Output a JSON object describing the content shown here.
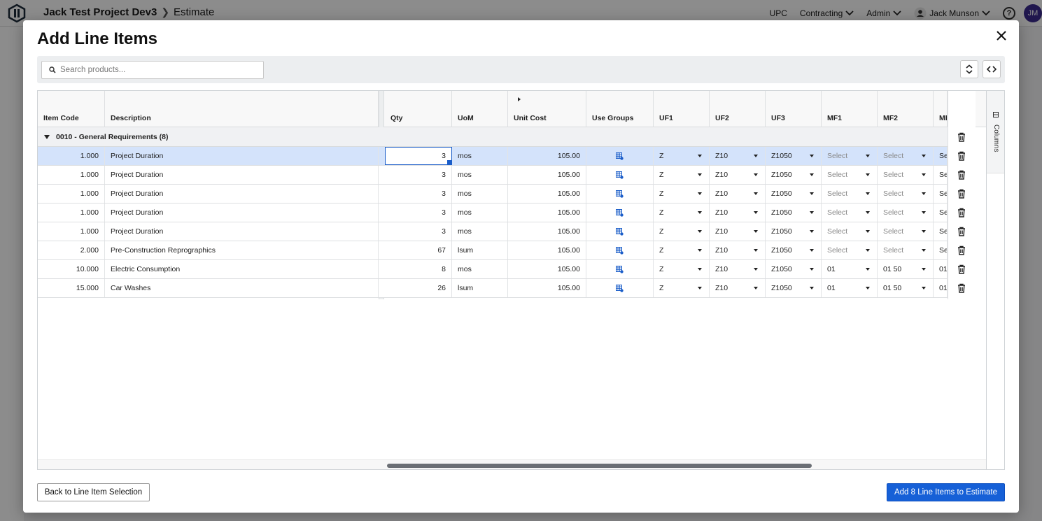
{
  "app": {
    "project": "Jack Test Project Dev3",
    "page": "Estimate",
    "nav": [
      "UPC",
      "Contracting",
      "Admin"
    ],
    "user_name": "Jack Munson",
    "user_initials": "JM",
    "help_glyph": "?"
  },
  "modal": {
    "title": "Add Line Items",
    "search_placeholder": "Search products...",
    "back_button": "Back to Line Item Selection",
    "add_button": "Add 8 Line Items to Estimate",
    "columns_panel_label": "Columns"
  },
  "grid": {
    "headers": {
      "item_code": "Item Code",
      "description": "Description",
      "qty": "Qty",
      "uom": "UoM",
      "unit_cost": "Unit Cost",
      "use_groups": "Use Groups",
      "uf1": "UF1",
      "uf2": "UF2",
      "uf3": "UF3",
      "mf1": "MF1",
      "mf2": "MF2",
      "mf3": "MF"
    },
    "group_label": "0010 - General Requirements (8)",
    "rows": [
      {
        "item_code": "1.000",
        "description": "Project Duration",
        "qty": "3",
        "uom": "mos",
        "unit_cost": "105.00",
        "uf1": "Z",
        "uf2": "Z10",
        "uf3": "Z1050",
        "mf1": "Select",
        "mf2": "Select",
        "mf3": "Se",
        "selected": true
      },
      {
        "item_code": "1.000",
        "description": "Project Duration",
        "qty": "3",
        "uom": "mos",
        "unit_cost": "105.00",
        "uf1": "Z",
        "uf2": "Z10",
        "uf3": "Z1050",
        "mf1": "Select",
        "mf2": "Select",
        "mf3": "Se"
      },
      {
        "item_code": "1.000",
        "description": "Project Duration",
        "qty": "3",
        "uom": "mos",
        "unit_cost": "105.00",
        "uf1": "Z",
        "uf2": "Z10",
        "uf3": "Z1050",
        "mf1": "Select",
        "mf2": "Select",
        "mf3": "Se"
      },
      {
        "item_code": "1.000",
        "description": "Project Duration",
        "qty": "3",
        "uom": "mos",
        "unit_cost": "105.00",
        "uf1": "Z",
        "uf2": "Z10",
        "uf3": "Z1050",
        "mf1": "Select",
        "mf2": "Select",
        "mf3": "Se"
      },
      {
        "item_code": "1.000",
        "description": "Project Duration",
        "qty": "3",
        "uom": "mos",
        "unit_cost": "105.00",
        "uf1": "Z",
        "uf2": "Z10",
        "uf3": "Z1050",
        "mf1": "Select",
        "mf2": "Select",
        "mf3": "Se"
      },
      {
        "item_code": "2.000",
        "description": "Pre-Construction Reprographics",
        "qty": "67",
        "uom": "lsum",
        "unit_cost": "105.00",
        "uf1": "Z",
        "uf2": "Z10",
        "uf3": "Z1050",
        "mf1": "Select",
        "mf2": "Select",
        "mf3": "Se"
      },
      {
        "item_code": "10.000",
        "description": "Electric Consumption",
        "qty": "8",
        "uom": "mos",
        "unit_cost": "105.00",
        "uf1": "Z",
        "uf2": "Z10",
        "uf3": "Z1050",
        "mf1": "01",
        "mf2": "01 50",
        "mf3": "01"
      },
      {
        "item_code": "15.000",
        "description": "Car Washes",
        "qty": "26",
        "uom": "lsum",
        "unit_cost": "105.00",
        "uf1": "Z",
        "uf2": "Z10",
        "uf3": "Z1050",
        "mf1": "01",
        "mf2": "01 50",
        "mf3": "01"
      }
    ]
  },
  "colors": {
    "accent": "#1660d7",
    "selected_row": "#d4e3fb",
    "use_groups_icon": "#1a5dc9"
  },
  "icons": [
    "logo-icon",
    "chevron-right-icon",
    "chevron-down-icon",
    "user-icon",
    "help-icon",
    "close-icon",
    "search-icon",
    "expand-collapse-icon",
    "code-toggle-icon",
    "caret-down-icon",
    "use-groups-icon",
    "trash-icon",
    "columns-icon"
  ]
}
